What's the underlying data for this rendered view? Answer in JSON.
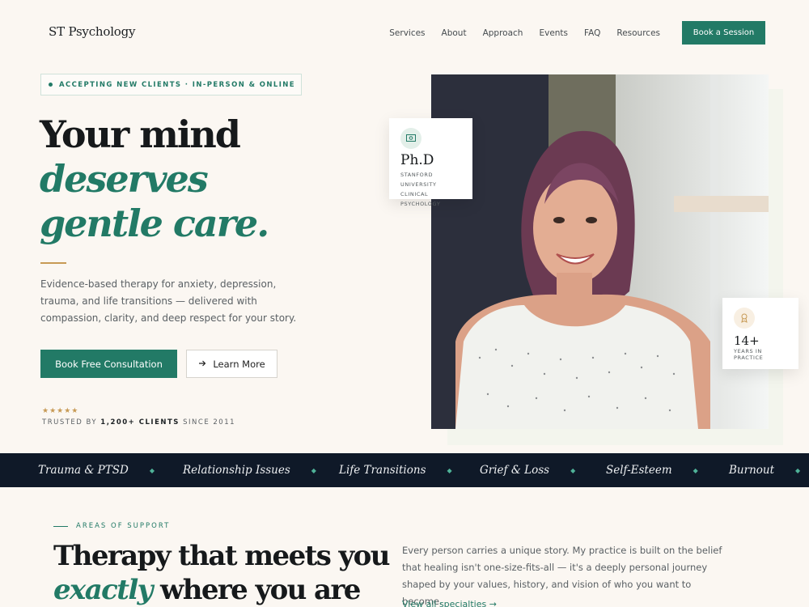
{
  "brand": {
    "logo": "ST Psychology"
  },
  "nav": {
    "items": [
      "Services",
      "About",
      "Approach",
      "Events",
      "FAQ",
      "Resources"
    ],
    "cta": "Book a Session"
  },
  "hero": {
    "pill": "ACCEPTING NEW CLIENTS · IN-PERSON & ONLINE",
    "headline_1": "Your mind",
    "headline_2": "deserves",
    "headline_3": "gentle care.",
    "lede": "Evidence-based therapy for anxiety, depression, trauma, and life transitions — delivered with compassion, clarity, and deep respect for your story.",
    "primary_button": "Book Free Consultation",
    "secondary_button": "Learn More",
    "stars": "★★★★★",
    "trust_pre": "TRUSTED BY ",
    "trust_bold": "1,200+ CLIENTS",
    "trust_post": " SINCE 2011"
  },
  "badges": {
    "phd_title": "Ph.D",
    "phd_sub": "STANFORD UNIVERSITY CLINICAL PSYCHOLOGY",
    "years_num": "14+",
    "years_label": "YEARS IN PRACTICE"
  },
  "ticker": [
    "Trauma & PTSD",
    "Relationship Issues",
    "Life Transitions",
    "Grief & Loss",
    "Self-Esteem",
    "Burnout"
  ],
  "support": {
    "eyebrow": "AREAS OF SUPPORT",
    "title_1": "Therapy that meets you",
    "title_2_italic": "exactly",
    "title_2_rest": " where you are",
    "copy": "Every person carries a unique story. My practice is built on the belief that healing isn't one-size-fits-all — it's a deeply personal journey shaped by your values, history, and vision of who you want to become.",
    "link": "View all specialties →"
  },
  "colors": {
    "accent": "#227a66",
    "gold": "#c79a55",
    "ink": "#0f1928",
    "background": "#fbf7f2"
  }
}
